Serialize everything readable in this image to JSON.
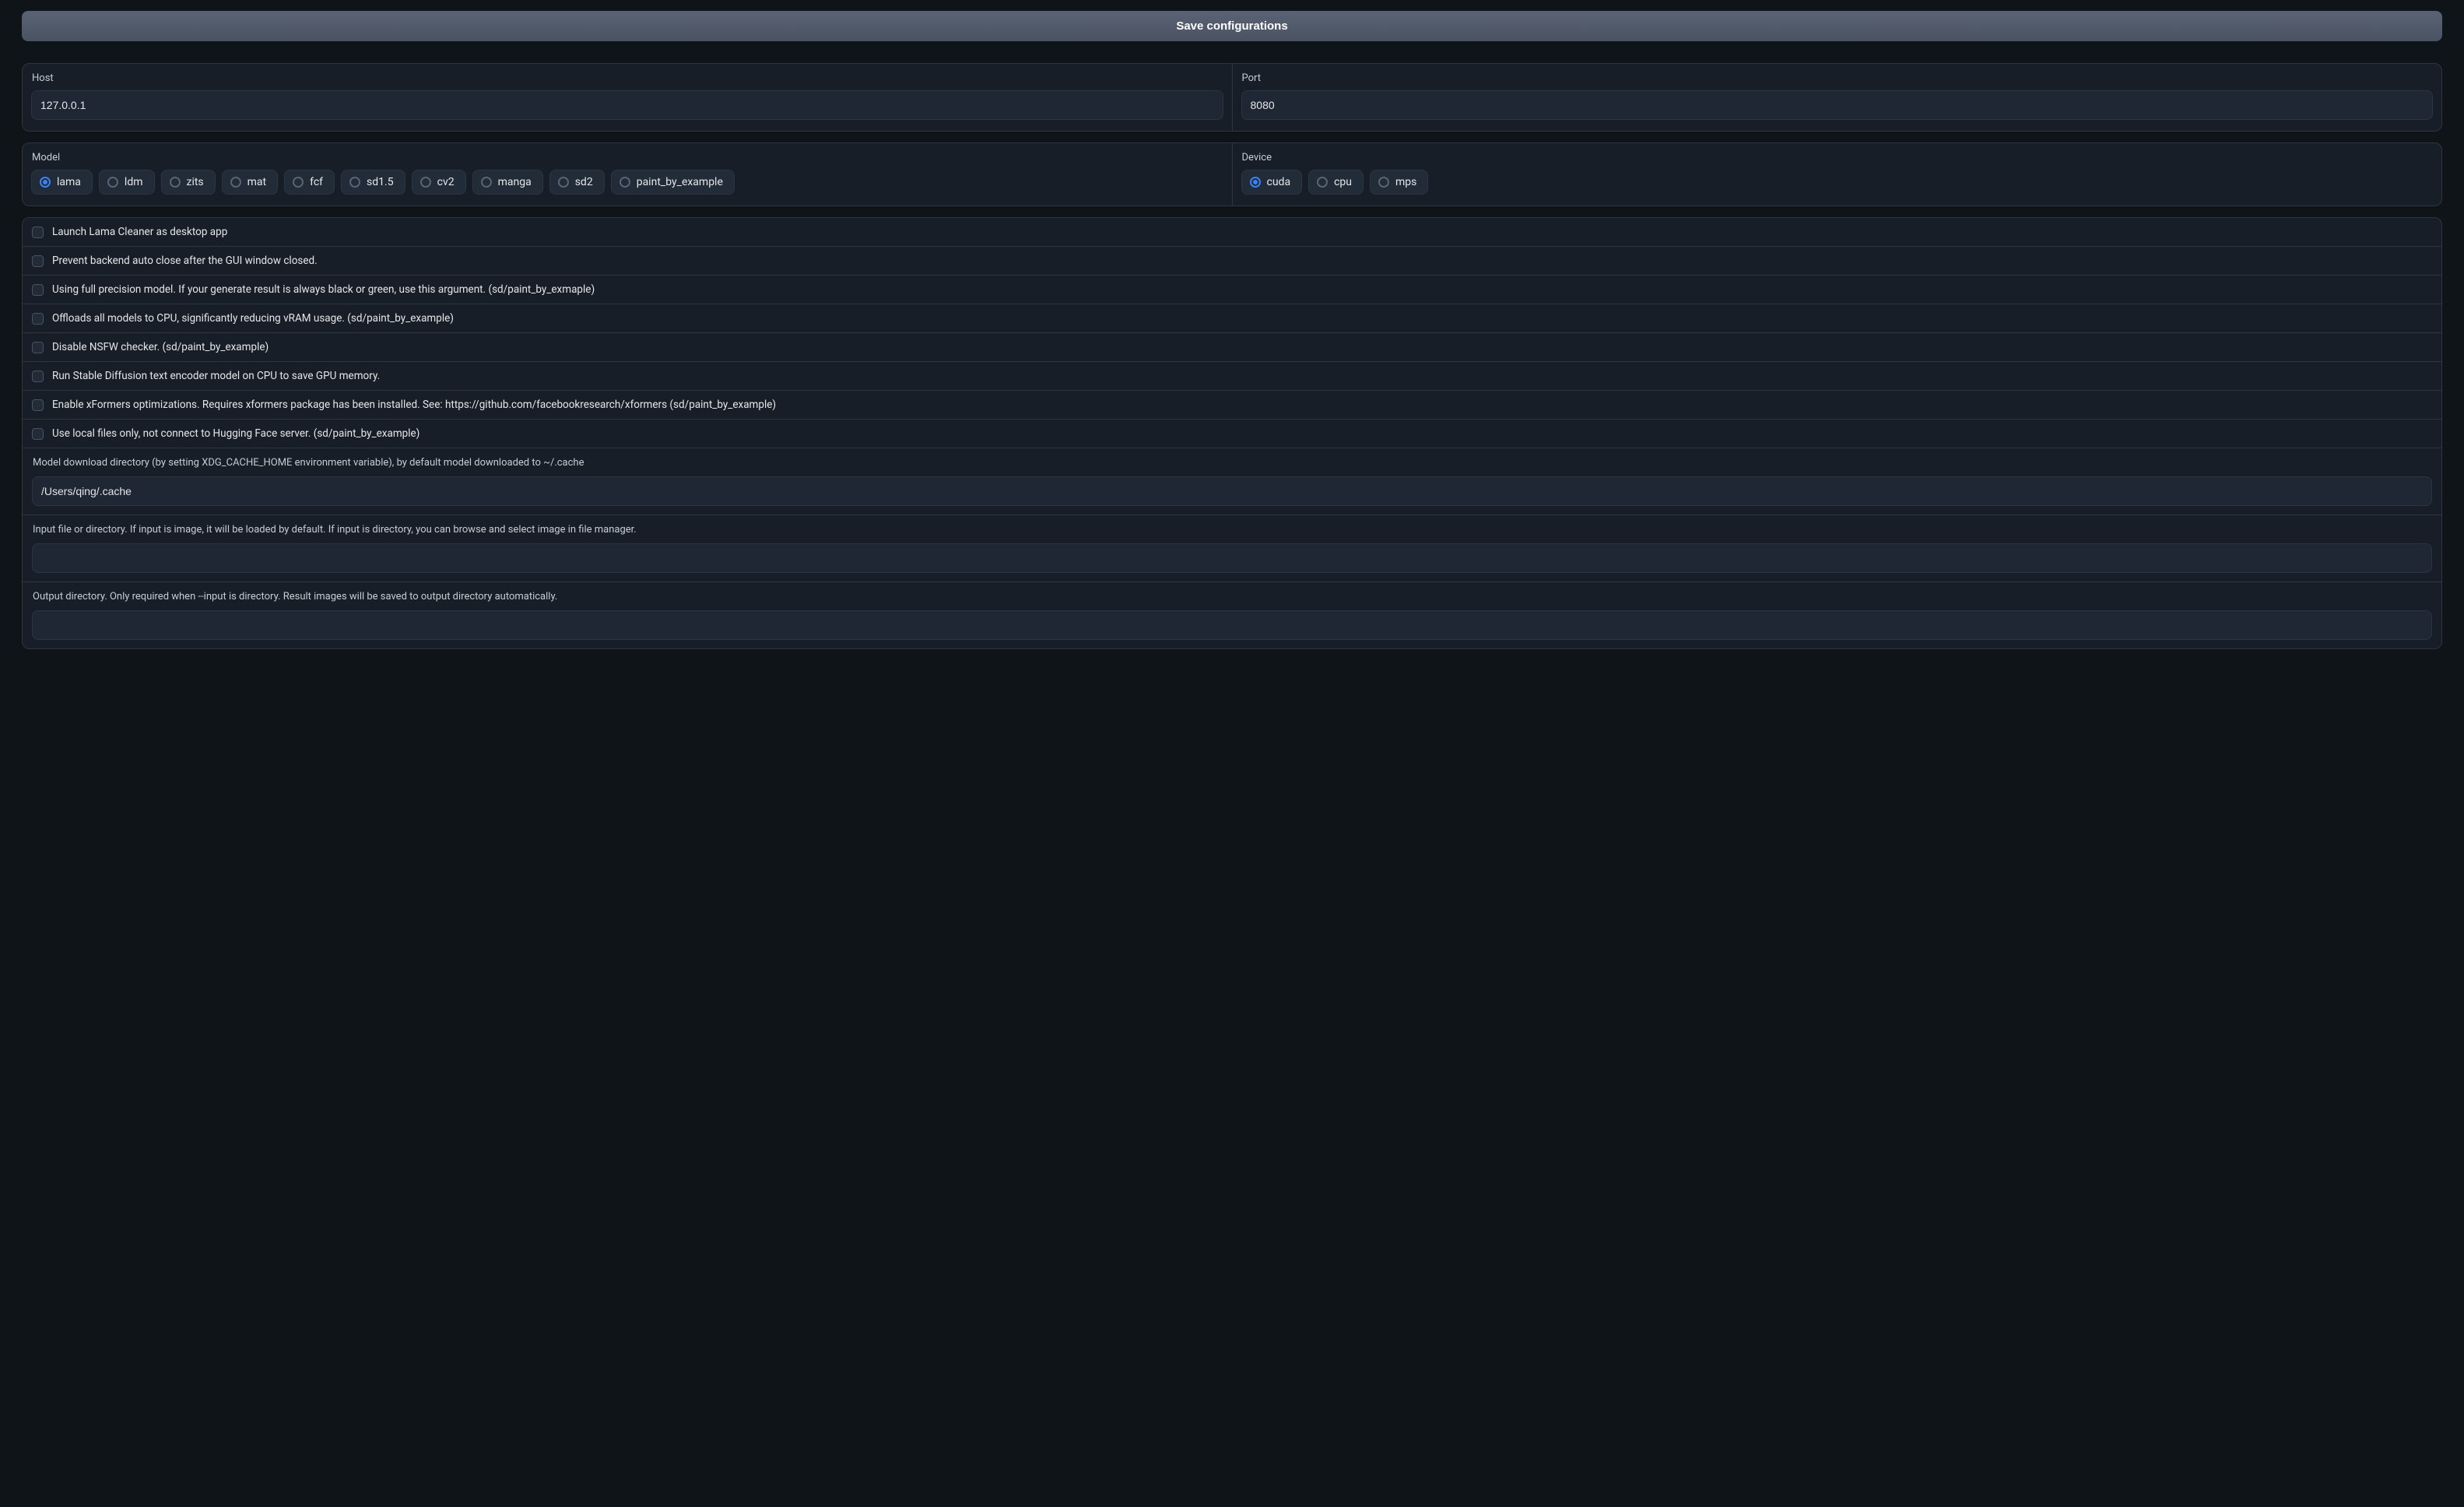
{
  "save_button": "Save configurations",
  "network": {
    "host_label": "Host",
    "host_value": "127.0.0.1",
    "port_label": "Port",
    "port_value": "8080"
  },
  "model": {
    "label": "Model",
    "selected": "lama",
    "options": [
      "lama",
      "ldm",
      "zits",
      "mat",
      "fcf",
      "sd1.5",
      "cv2",
      "manga",
      "sd2",
      "paint_by_example"
    ]
  },
  "device": {
    "label": "Device",
    "selected": "cuda",
    "options": [
      "cuda",
      "cpu",
      "mps"
    ]
  },
  "checks": [
    "Launch Lama Cleaner as desktop app",
    "Prevent backend auto close after the GUI window closed.",
    "Using full precision model. If your generate result is always black or green, use this argument. (sd/paint_by_exmaple)",
    "Offloads all models to CPU, significantly reducing vRAM usage. (sd/paint_by_example)",
    "Disable NSFW checker. (sd/paint_by_example)",
    "Run Stable Diffusion text encoder model on CPU to save GPU memory.",
    "Enable xFormers optimizations. Requires xformers package has been installed. See: https://github.com/facebookresearch/xformers (sd/paint_by_example)",
    "Use local files only, not connect to Hugging Face server. (sd/paint_by_example)"
  ],
  "paths": {
    "cache_label": "Model download directory (by setting XDG_CACHE_HOME environment variable), by default model downloaded to ~/.cache",
    "cache_value": "/Users/qing/.cache",
    "input_label": "Input file or directory. If input is image, it will be loaded by default. If input is directory, you can browse and select image in file manager.",
    "input_value": "",
    "output_label": "Output directory. Only required when --input is directory. Result images will be saved to output directory automatically.",
    "output_value": ""
  }
}
